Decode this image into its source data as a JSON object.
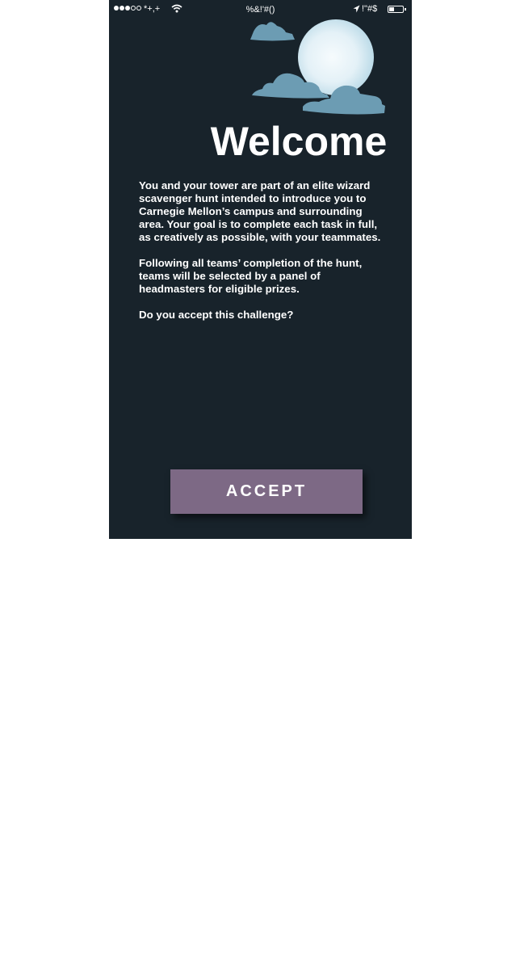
{
  "status_bar": {
    "signal_dots": [
      true,
      true,
      true,
      false,
      false
    ],
    "carrier": "*+,+",
    "time": "%&!'#()",
    "battery_percent": "!\"#$",
    "battery_level": 0.4
  },
  "header": {
    "title": "Welcome"
  },
  "body": {
    "paragraphs": [
      "You and your tower are part of an elite wizard scavenger hunt intended to introduce you to Carnegie Mellon’s campus and surrounding area. Your goal is to complete each task in full, as creatively as possible, with your teammates.",
      "Following all teams’ completion of the hunt, teams will be selected by a panel of headmasters for eligible prizes.",
      "Do you accept this challenge?"
    ]
  },
  "actions": {
    "accept_label": "ACCEPT"
  },
  "colors": {
    "background": "#18232b",
    "button": "#7d6985",
    "cloud": "#6c9cb3",
    "moon_center": "#f2f9fc",
    "moon_edge": "#c2dfea",
    "page": "#ffffff"
  }
}
